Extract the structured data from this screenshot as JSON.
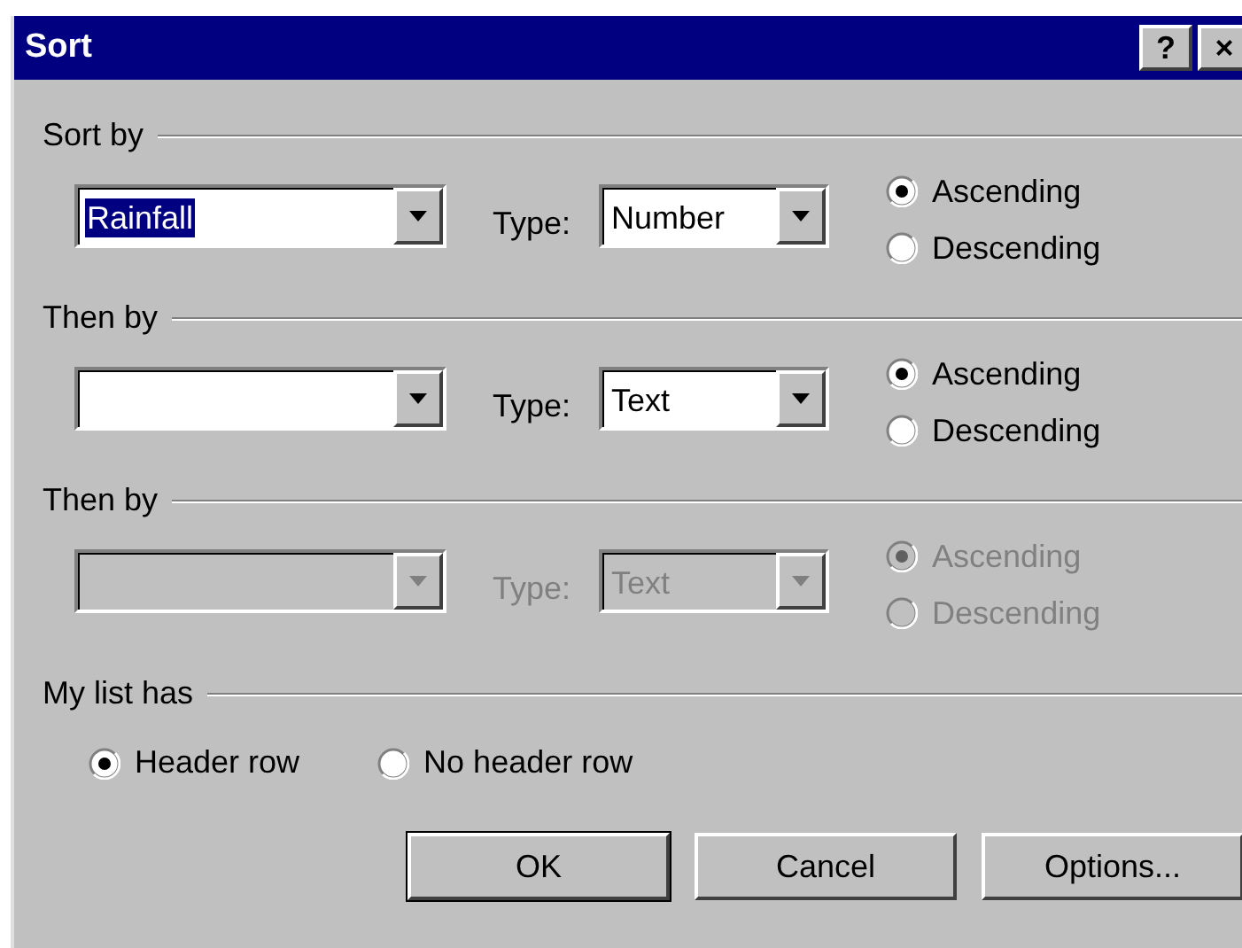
{
  "window": {
    "title": "Sort",
    "title_buttons": [
      "?",
      "×"
    ]
  },
  "sort_levels": [
    {
      "label": "Sort by",
      "disabled": false,
      "field": {
        "value": "Rainfall",
        "highlighted": true
      },
      "type_label": "Type:",
      "type": {
        "value": "Number"
      },
      "orders": [
        {
          "label": "Ascending",
          "selected": true
        },
        {
          "label": "Descending",
          "selected": false
        }
      ]
    },
    {
      "label": "Then by",
      "disabled": false,
      "type_label": "Type:",
      "type": {
        "value": "Text"
      },
      "orders": [
        {
          "label": "Ascending",
          "selected": true
        },
        {
          "label": "Descending",
          "selected": false
        }
      ]
    },
    {
      "label": "Then by",
      "disabled": true,
      "type_label": "Type:",
      "type": {
        "value": "Text"
      },
      "orders": [
        {
          "label": "Ascending",
          "selected": true
        },
        {
          "label": "Descending",
          "selected": false
        }
      ]
    }
  ],
  "header": {
    "label": "My list has",
    "options": [
      {
        "label": "Header row",
        "selected": true
      },
      {
        "label": "No header row",
        "selected": false
      }
    ]
  },
  "buttons": [
    {
      "label": "OK",
      "default": true
    },
    {
      "label": "Cancel",
      "default": false
    },
    {
      "label": "Options...",
      "default": false
    }
  ]
}
